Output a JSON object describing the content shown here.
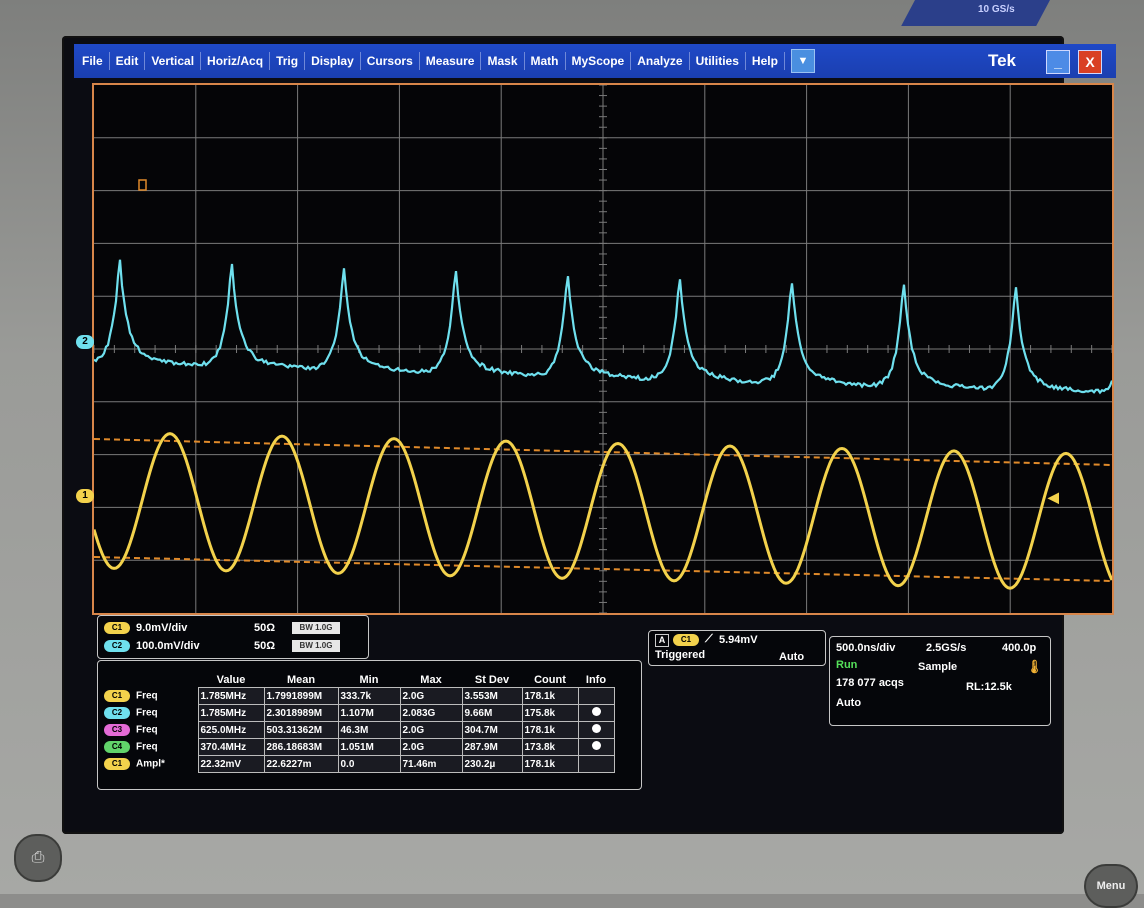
{
  "corner": {
    "line1": "",
    "line2": "10 GS/s"
  },
  "menu": {
    "items": [
      "File",
      "Edit",
      "Vertical",
      "Horiz/Acq",
      "Trig",
      "Display",
      "Cursors",
      "Measure",
      "Mask",
      "Math",
      "MyScope",
      "Analyze",
      "Utilities",
      "Help"
    ],
    "dropdown": "▼",
    "brand": "Tek",
    "min_label": "_",
    "close_label": "X"
  },
  "markers": {
    "ch2": "2",
    "ch1": "1"
  },
  "channels": [
    {
      "tag": "C1",
      "scale": "9.0mV/div",
      "impedance": "50Ω",
      "bw": "BW 1.0G",
      "color": "#f3d24c"
    },
    {
      "tag": "C2",
      "scale": "100.0mV/div",
      "impedance": "50Ω",
      "bw": "BW 1.0G",
      "color": "#6fe0ee"
    }
  ],
  "trigger": {
    "source_mode": "A",
    "source": "C1",
    "level": "5.94mV",
    "state": "Triggered",
    "mode": "Auto"
  },
  "acquisition": {
    "timebase": "500.0ns/div",
    "sample_rate": "2.5GS/s",
    "resolution": "400.0p",
    "state": "Run",
    "acq_mode": "Sample",
    "acqs": "178 077 acqs",
    "record_length": "RL:12.5k",
    "trigger_mode": "Auto"
  },
  "measurements": {
    "headers": [
      "Value",
      "Mean",
      "Min",
      "Max",
      "St Dev",
      "Count",
      "Info"
    ],
    "rows": [
      {
        "tag": "C1",
        "color": "#f3d24c",
        "name": "Freq",
        "value": "1.785MHz",
        "mean": "1.7991899M",
        "min": "333.7k",
        "max": "2.0G",
        "stdev": "3.553M",
        "count": "178.1k",
        "info": false
      },
      {
        "tag": "C2",
        "color": "#6fe0ee",
        "name": "Freq",
        "value": "1.785MHz",
        "mean": "2.3018989M",
        "min": "1.107M",
        "max": "2.083G",
        "stdev": "9.66M",
        "count": "175.8k",
        "info": true
      },
      {
        "tag": "C3",
        "color": "#e46ad6",
        "name": "Freq",
        "value": "625.0MHz",
        "mean": "503.31362M",
        "min": "46.3M",
        "max": "2.0G",
        "stdev": "304.7M",
        "count": "178.1k",
        "info": true
      },
      {
        "tag": "C4",
        "color": "#61d36a",
        "name": "Freq",
        "value": "370.4MHz",
        "mean": "286.18683M",
        "min": "1.051M",
        "max": "2.0G",
        "stdev": "287.9M",
        "count": "173.8k",
        "info": true
      },
      {
        "tag": "C1",
        "color": "#f3d24c",
        "name": "Ampl*",
        "value": "22.32mV",
        "mean": "22.6227m",
        "min": "0.0",
        "max": "71.46m",
        "stdev": "230.2µ",
        "count": "178.1k",
        "info": false
      }
    ]
  },
  "hw_buttons": {
    "print": "⎙",
    "menu": "Menu"
  },
  "waveforms": {
    "ch1_color": "#f3d24c",
    "ch2_color": "#6fe0ee",
    "grid_color": "#7a7a7a",
    "cursor_color": "#e08a2a"
  }
}
